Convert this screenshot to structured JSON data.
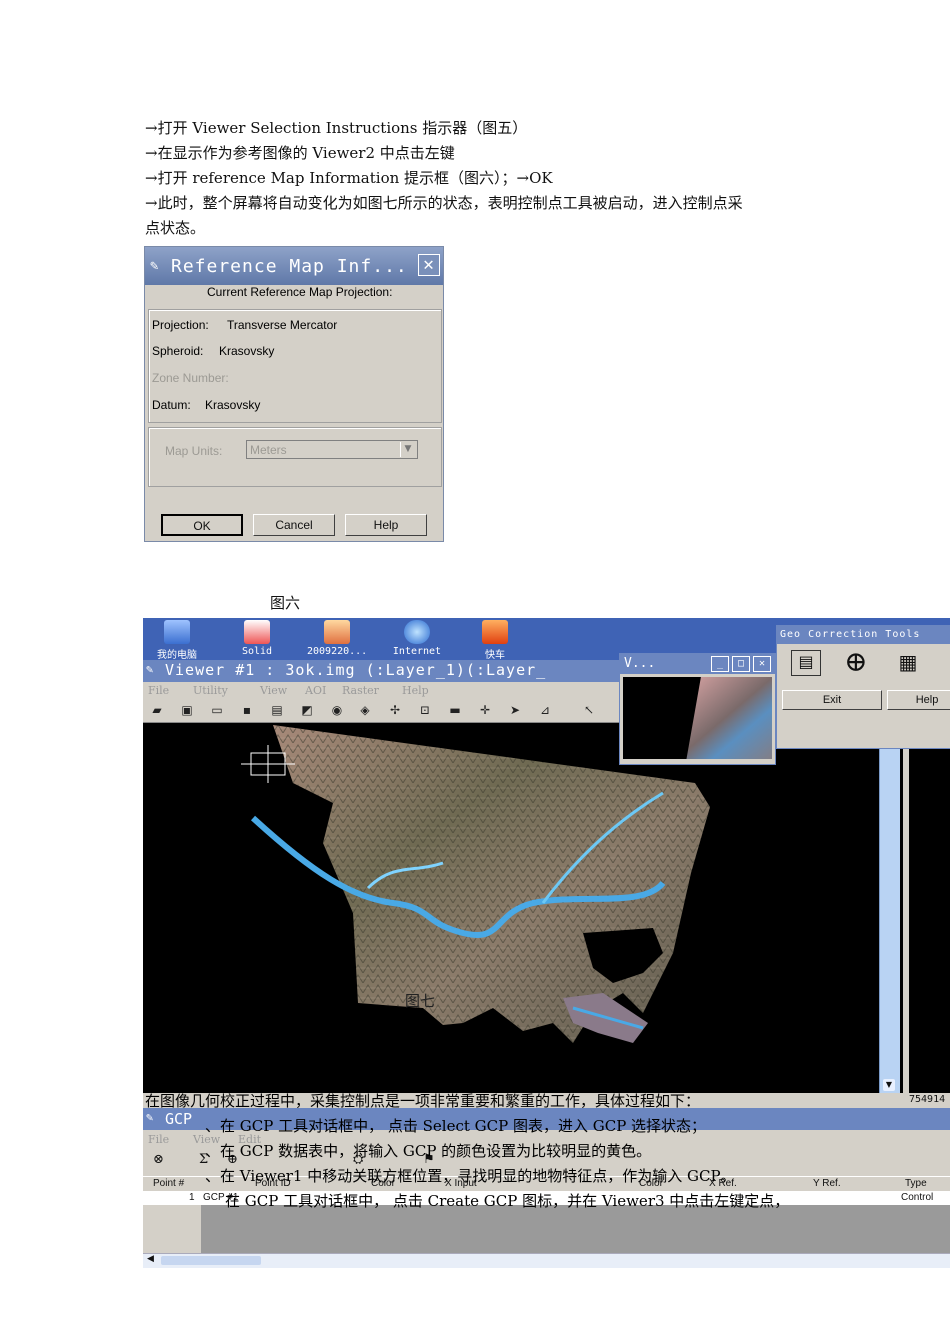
{
  "paragraphs": [
    "→打开 Viewer Selection Instructions 指示器（图五）",
    "→在显示作为参考图像的 Viewer2 中点击左键",
    "→打开 reference Map Information  提示框（图六）；→OK",
    "→此时，整个屏幕将自动变化为如图七所示的状态，表明控制点工具被启动，进入控制点采",
    "点状态。"
  ],
  "dialog": {
    "title": "Reference Map Inf...",
    "heading": "Current Reference Map Projection:",
    "projection_label": "Projection:",
    "projection_value": "Transverse Mercator",
    "spheroid_label": "Spheroid:",
    "spheroid_value": "Krasovsky",
    "zone_label": "Zone Number:",
    "datum_label": "Datum:",
    "datum_value": "Krasovsky",
    "map_units_label": "Map Units:",
    "map_units_value": "Meters",
    "ok": "OK",
    "cancel": "Cancel",
    "help": "Help"
  },
  "figure6_caption": "图六",
  "figure7_caption": "图七",
  "screenshot": {
    "desktop_icons": [
      "我的电脑",
      "Solid",
      "2009220...",
      "Internet",
      "快车"
    ],
    "viewer_title": "Viewer #1 : 3ok.img (:Layer_1)(:Layer_",
    "viewer_menu": [
      "File",
      "Utility",
      "View",
      "AOI",
      "Raster",
      "Help"
    ],
    "small_viewer_title": "V...",
    "geo_tools_title": "Geo Correction Tools",
    "geo_exit": "Exit",
    "geo_help": "Help",
    "coord_readout": "754914",
    "gcp_title": "GCP",
    "gcp_menu": [
      "File",
      "View",
      "Edit"
    ],
    "gcp_columns": [
      "Point #",
      "Point ID",
      "Color",
      "X Input",
      "Color",
      "X Ref.",
      "Y Ref.",
      "Type"
    ],
    "gcp_row": [
      "1",
      "GCP #1",
      "",
      "",
      "",
      "",
      "",
      "Control"
    ]
  },
  "overlay_lines": [
    "在图像几何校正过程中，采集控制点是一项非常重要和繁重的工作，具体过程如下：",
    "、在 GCP 工具对话框中，  点击 Select GCP 图表，进入 GCP 选择状态；",
    "、在 GCP 数据表中，将输入 GCP 的颜色设置为比较明显的黄色。",
    "、在 Viewer1 中移动关联方框位置，寻找明显的地物特征点，作为输入 GCP。",
    "在 GCP 工具对话框中，  点击 Create  GCP 图标，并在 Viewer3 中点击左键定点，"
  ]
}
